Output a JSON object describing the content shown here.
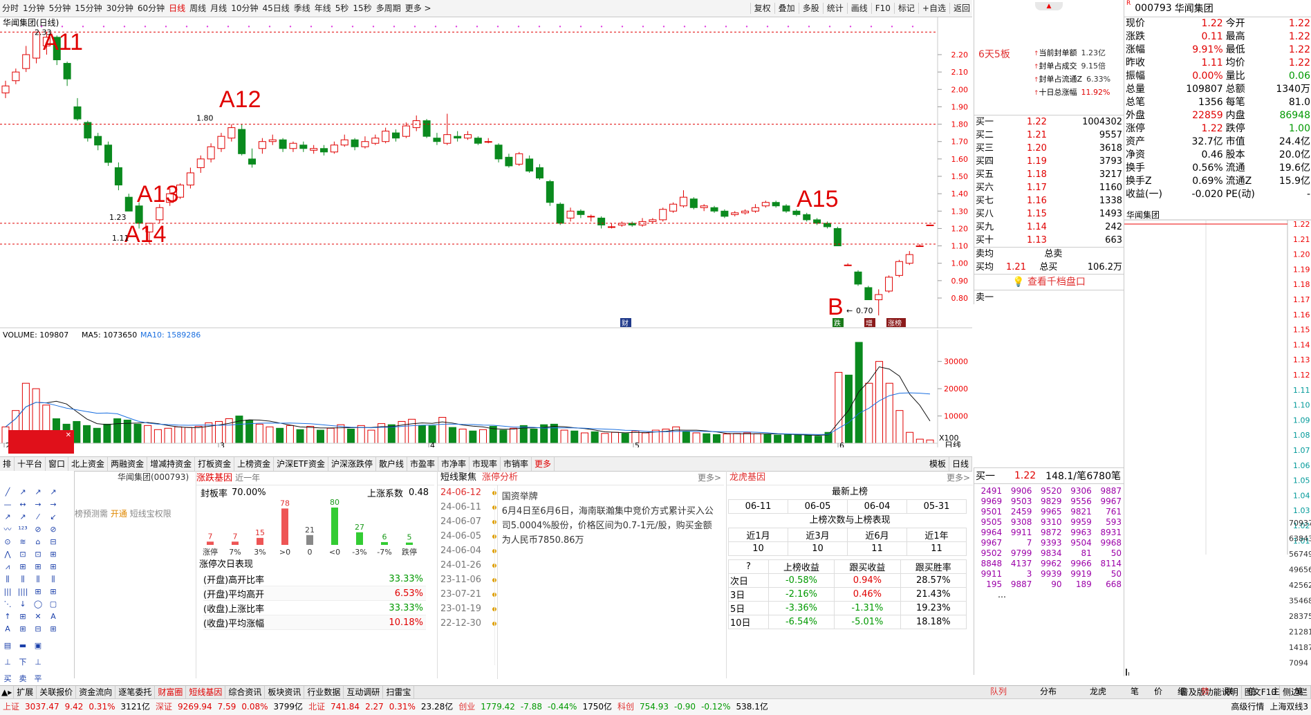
{
  "toolbar": {
    "periods": [
      "分时",
      "1分钟",
      "5分钟",
      "15分钟",
      "30分钟",
      "60分钟",
      "日线",
      "周线",
      "月线",
      "10分钟",
      "45日线",
      "季线",
      "年线",
      "5秒",
      "15秒",
      "多周期",
      "更多 >"
    ],
    "active_period": "日线",
    "right_buttons": [
      "复权",
      "叠加",
      "多股",
      "统计",
      "画线",
      "F10",
      "标记",
      "+自选",
      "返回"
    ]
  },
  "kchart": {
    "title": "华闻集团(日线)",
    "price_axis": [
      "2.20",
      "2.10",
      "2.00",
      "1.90",
      "1.80",
      "1.70",
      "1.60",
      "1.50",
      "1.40",
      "1.30",
      "1.20",
      "1.10",
      "1.00",
      "0.90",
      "0.80"
    ],
    "annotations": [
      "A11",
      "A12",
      "A13",
      "A14",
      "A15",
      "B"
    ],
    "price_labels": [
      "2.33",
      "1.80",
      "1.23",
      "1.11",
      "0.70"
    ],
    "event_tags": [
      "财",
      "跌",
      "增",
      "涨榜"
    ]
  },
  "volchart": {
    "title": "VOLUME: 109807",
    "ma5": "MA5: 1073650",
    "ma10": "MA10: 1589286",
    "axis": [
      "30000",
      "20000",
      "10000",
      "X100"
    ],
    "month_labels": [
      "2",
      "3",
      "4",
      "5",
      "6"
    ],
    "period_label": "日线"
  },
  "chart_data": [
    {
      "type": "candlestick",
      "title": "华闻集团(日线)",
      "ylim": [
        0.7,
        2.33
      ],
      "marked_prices": {
        "high": 2.33,
        "local_high": 1.8,
        "support_1": 1.23,
        "support_2": 1.11,
        "low": 0.7
      },
      "annotations": [
        "A11",
        "A12",
        "A13",
        "A14",
        "A15",
        "B"
      ]
    },
    {
      "type": "bar",
      "title": "VOLUME",
      "unit": "X100",
      "ticks": [
        10000,
        20000,
        30000
      ],
      "latest_volume": 109807,
      "ma5": 1073650,
      "ma10": 1589286
    }
  ],
  "info": {
    "board": "6天5板",
    "lines": [
      {
        "label": "当前封单额",
        "value": "1.23亿"
      },
      {
        "label": "封单占成交",
        "value": "9.15倍"
      },
      {
        "label": "封单占流通Z",
        "value": "6.33%"
      },
      {
        "label": "十日总涨幅",
        "value": "11.92%"
      }
    ],
    "buy_levels": [
      {
        "label": "买一",
        "price": "1.22",
        "vol": "1004302"
      },
      {
        "label": "买二",
        "price": "1.21",
        "vol": "9557"
      },
      {
        "label": "买三",
        "price": "1.20",
        "vol": "3618"
      },
      {
        "label": "买四",
        "price": "1.19",
        "vol": "3793"
      },
      {
        "label": "买五",
        "price": "1.18",
        "vol": "3217"
      },
      {
        "label": "买六",
        "price": "1.17",
        "vol": "1160"
      },
      {
        "label": "买七",
        "price": "1.16",
        "vol": "1338"
      },
      {
        "label": "买八",
        "price": "1.15",
        "vol": "1493"
      },
      {
        "label": "买九",
        "price": "1.14",
        "vol": "242"
      },
      {
        "label": "买十",
        "price": "1.13",
        "vol": "663"
      }
    ],
    "sell_avg_label": "卖均",
    "sell_total_label": "总卖",
    "buy_avg_label": "买均",
    "buy_avg": "1.21",
    "buy_total_label": "总买",
    "buy_total": "106.2万",
    "view_depth": "查看千档盘口",
    "sell1_label": "卖一"
  },
  "quote": {
    "code": "000793",
    "name": "华闻集团",
    "rows": [
      [
        "现价",
        "1.22",
        "今开",
        "1.22"
      ],
      [
        "涨跌",
        "0.11",
        "最高",
        "1.22"
      ],
      [
        "涨幅",
        "9.91%",
        "最低",
        "1.22"
      ],
      [
        "昨收",
        "1.11",
        "均价",
        "1.22"
      ],
      [
        "振幅",
        "0.00%",
        "量比",
        "0.06"
      ],
      [
        "总量",
        "109807",
        "总额",
        "1340万"
      ],
      [
        "总笔",
        "1356",
        "每笔",
        "81.0"
      ],
      [
        "外盘",
        "22859",
        "内盘",
        "86948"
      ],
      [
        "涨停",
        "1.22",
        "跌停",
        "1.00"
      ],
      [
        "资产",
        "32.7亿",
        "市值",
        "24.4亿"
      ],
      [
        "净资",
        "0.46",
        "股本",
        "20.0亿"
      ],
      [
        "换手",
        "0.56%",
        "流通",
        "19.6亿"
      ],
      [
        "换手Z",
        "0.69%",
        "流通Z",
        "15.9亿"
      ],
      [
        "收益(一)",
        "-0.020",
        "PE(动)",
        "-"
      ]
    ]
  },
  "intraday": {
    "title": "华闻集团",
    "price_axis": [
      "1.22",
      "1.21",
      "1.20",
      "1.19",
      "1.18",
      "1.17",
      "1.16",
      "1.15",
      "1.14",
      "1.13",
      "1.12",
      "1.11",
      "1.10",
      "1.09",
      "1.08",
      "1.07",
      "1.06",
      "1.05",
      "1.04",
      "1.03",
      "1.02",
      "1.01"
    ],
    "vol_axis": [
      "70937",
      "63843",
      "56749",
      "49656",
      "42562",
      "35468",
      "28375",
      "21281",
      "14187",
      "7094"
    ]
  },
  "trades": {
    "header": {
      "label": "买一",
      "price": "1.22",
      "amount": "148.1/笔",
      "count": "6780笔"
    },
    "grid": [
      [
        "2491",
        "9906",
        "9520",
        "9306",
        "9887"
      ],
      [
        "9969",
        "9503",
        "9829",
        "9556",
        "9967"
      ],
      [
        "9501",
        "2459",
        "9965",
        "9821",
        "761"
      ],
      [
        "9505",
        "9308",
        "9310",
        "9959",
        "593"
      ],
      [
        "9964",
        "9911",
        "9872",
        "9963",
        "8931"
      ],
      [
        "9967",
        "7",
        "9393",
        "9504",
        "9968"
      ],
      [
        "9502",
        "9799",
        "9834",
        "81",
        "50"
      ],
      [
        "8848",
        "4137",
        "9962",
        "9966",
        "8114"
      ],
      [
        "9911",
        "3",
        "9939",
        "9919",
        "50"
      ],
      [
        "195",
        "9887",
        "90",
        "189",
        "668"
      ]
    ],
    "more": "…"
  },
  "bottomtabs": {
    "items": [
      "排",
      "十平台",
      "窗口",
      "北上资金",
      "两融资金",
      "增减持资金",
      "打板资金",
      "上榜资金",
      "沪深ETF资金",
      "沪深涨跌停",
      "散户线",
      "市盈率",
      "市净率",
      "市现率",
      "市销率",
      "更多"
    ],
    "right": [
      "模板",
      "日线"
    ]
  },
  "stockbox": {
    "name": "华闻集团(000793)",
    "line1": "榜预测需",
    "link": "开通",
    "line2": "短线宝权限"
  },
  "zt": {
    "title": "涨跌基因",
    "sub": "近一年",
    "seal_rate_label": "封板率",
    "seal_rate": "70.00%",
    "coef_label": "上涨系数",
    "coef": "0.48",
    "bars": [
      {
        "label": "涨停",
        "value": "7",
        "color": "#e55"
      },
      {
        "label": "7%",
        "value": "7",
        "color": "#e55"
      },
      {
        "label": "3%",
        "value": "15",
        "color": "#e55"
      },
      {
        "label": ">0",
        "value": "78",
        "color": "#e55"
      },
      {
        "label": "0",
        "value": "21",
        "color": "#888"
      },
      {
        "label": "<0",
        "value": "80",
        "color": "#3c3"
      },
      {
        "label": "-3%",
        "value": "27",
        "color": "#3c3"
      },
      {
        "label": "-7%",
        "value": "6",
        "color": "#3c3"
      },
      {
        "label": "跌停",
        "value": "5",
        "color": "#3c3"
      }
    ],
    "next_title": "涨停次日表现",
    "next": [
      {
        "label": "(开盘)高开比率",
        "value": "33.33%",
        "color": "green"
      },
      {
        "label": "(开盘)平均高开",
        "value": "6.53%",
        "color": "red"
      },
      {
        "label": "(收盘)上涨比率",
        "value": "33.33%",
        "color": "green"
      },
      {
        "label": "(收盘)平均涨幅",
        "value": "10.18%",
        "color": "red"
      }
    ]
  },
  "news": {
    "tab1": "短线聚焦",
    "tab2": "涨停分析",
    "more": "更多>",
    "dates": [
      "24-06-12",
      "24-06-11",
      "24-06-07",
      "24-06-05",
      "24-06-04",
      "24-01-26",
      "23-11-06",
      "23-07-21",
      "23-01-19",
      "22-12-30"
    ],
    "headline": "国资举牌",
    "body": "6月4日至6月6日，海南联瀚集中竞价方式累计买入公司5.0004%股份，价格区间为0.7-1元/股，购买金额为人民币7850.86万"
  },
  "lhb": {
    "title": "龙虎基因",
    "more": "更多>",
    "latest_label": "最新上榜",
    "dates": [
      "06-11",
      "06-05",
      "06-04",
      "05-31"
    ],
    "count_title": "上榜次数与上榜表现",
    "periods": [
      "近1月",
      "近3月",
      "近6月",
      "近1年"
    ],
    "counts": [
      "10",
      "10",
      "11",
      "11"
    ],
    "head": [
      "?",
      "上榜收益",
      "跟买收益",
      "跟买胜率"
    ],
    "rows": [
      [
        "次日",
        "-0.58%",
        "0.94%",
        "28.57%"
      ],
      [
        "3日",
        "-2.16%",
        "0.46%",
        "21.43%"
      ],
      [
        "5日",
        "-3.36%",
        "-1.31%",
        "19.23%"
      ],
      [
        "10日",
        "-6.54%",
        "-5.01%",
        "18.18%"
      ]
    ]
  },
  "statusbar": {
    "items": [
      "扩展",
      "关联报价",
      "资金流向",
      "逐笔委托",
      "财富圈",
      "短线基因",
      "综合资讯",
      "板块资讯",
      "行业数据",
      "互动调研",
      "扫雷宝"
    ],
    "active": "短线基因",
    "right": [
      "普及版功能说明",
      "图文F10",
      "侧边栏"
    ]
  },
  "rightbottomtabs": [
    "队列",
    "分布",
    "龙虎",
    "笔",
    "价",
    "细",
    "势",
    "联",
    "值",
    "主",
    "笔"
  ],
  "indexbar": [
    {
      "name": "上证",
      "value": "3037.47",
      "chg": "9.42",
      "pct": "0.31%",
      "amt": "3121亿"
    },
    {
      "name": "深证",
      "value": "9269.94",
      "chg": "7.59",
      "pct": "0.08%",
      "amt": "3799亿"
    },
    {
      "name": "北证",
      "value": "741.84",
      "chg": "2.27",
      "pct": "0.31%",
      "amt": "23.28亿"
    },
    {
      "name": "创业",
      "value": "1779.42",
      "chg": "-7.88",
      "pct": "-0.44%",
      "amt": "1750亿"
    },
    {
      "name": "科创",
      "value": "754.93",
      "chg": "-0.90",
      "pct": "-0.12%",
      "amt": "538.1亿"
    }
  ],
  "indexbar_right": [
    "高级行情",
    "上海双线3"
  ]
}
